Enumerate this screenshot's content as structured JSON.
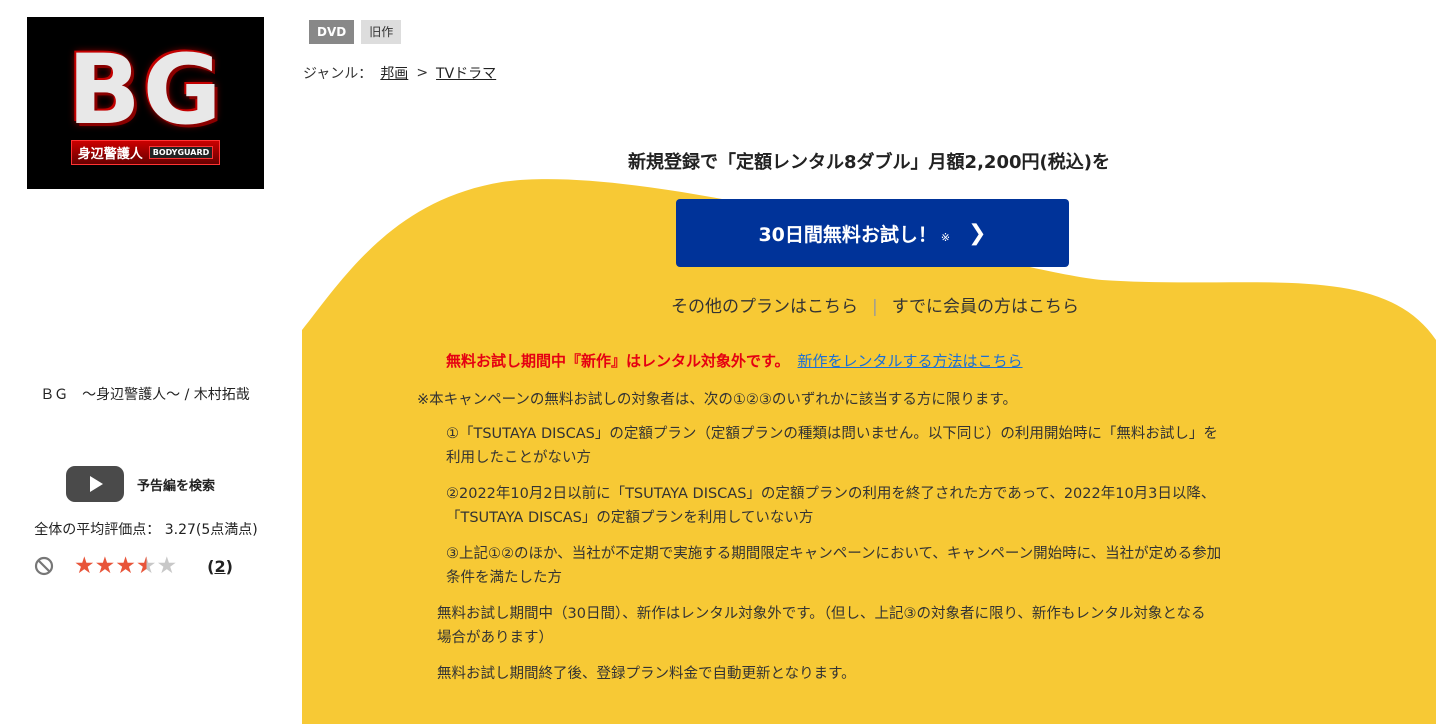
{
  "poster": {
    "logo_text": "BG",
    "logo_sub": "身辺警護人",
    "logo_badge": "BODYGUARD"
  },
  "left": {
    "title": "ＢＧ　～身辺警護人～ / 木村拓哉",
    "trailer_label": "予告編を検索",
    "avg_rating": "全体の平均評価点： 3.27(5点満点)",
    "rating_value": 3.27,
    "rating_max": 5,
    "review_count_open": "(",
    "review_count": "2",
    "review_count_close": ")"
  },
  "badges": [
    "DVD",
    "旧作"
  ],
  "genre": {
    "label": "ジャンル：",
    "items": [
      "邦画",
      "TVドラマ"
    ],
    "separator": ">"
  },
  "campaign": {
    "headline": "新規登録で「定額レンタル8ダブル」月額2,200円(税込)を",
    "cta_label": "30日間無料お試し！",
    "cta_note": "※",
    "other_plans": "その他のプランはこちら",
    "separator": "|",
    "member_link": "すでに会員の方はこちら",
    "notice_red": "無料お試し期間中『新作』はレンタル対象外です。",
    "notice_link": "新作をレンタルする方法はこちら",
    "terms_intro": "※本キャンペーンの無料お試しの対象者は、次の①②③のいずれかに該当する方に限ります。",
    "term1_line1": "①「TSUTAYA DISCAS」の定額プラン（定額プランの種類は問いません。以下同じ）の利用開始時に「無料お試し」を",
    "term1_line2": "利用したことがない方",
    "term2_line1": "②2022年10月2日以前に「TSUTAYA DISCAS」の定額プランの利用を終了された方であって、2022年10月3日以降、",
    "term2_line2": "「TSUTAYA DISCAS」の定額プランを利用していない方",
    "term3_line1": "③上記①②のほか、当社が不定期で実施する期間限定キャンペーンにおいて、キャンペーン開始時に、当社が定める参加",
    "term3_line2": "条件を満たした方",
    "foot1_line1": "無料お試し期間中（30日間）、新作はレンタル対象外です。（但し、上記③の対象者に限り、新作もレンタル対象となる",
    "foot1_line2": "場合があります）",
    "foot2": "無料お試し期間終了後、登録プラン料金で自動更新となります。"
  },
  "colors": {
    "yellow": "#f7c935",
    "cta_blue": "#003399",
    "red": "#e50012",
    "link_blue": "#1a6fd6",
    "star": "#e8553a"
  }
}
